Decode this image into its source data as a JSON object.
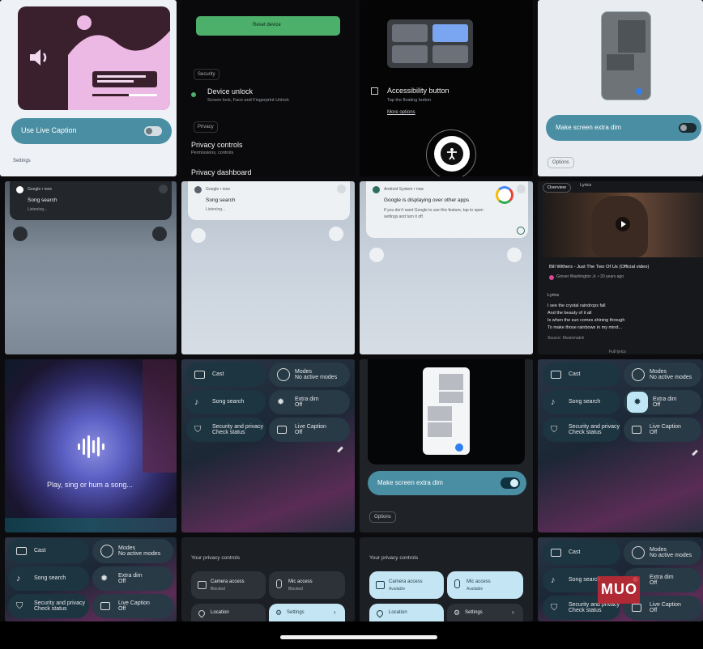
{
  "row1": {
    "t1": {
      "toggle_label": "Use Live Caption",
      "footer": "Settings"
    },
    "t2": {
      "button": "Reset device",
      "section_security": "Security",
      "device_unlock_title": "Device unlock",
      "device_unlock_sub": "Screen lock, Face and Fingerprint Unlock",
      "section_privacy": "Privacy",
      "privacy_controls_title": "Privacy controls",
      "privacy_controls_sub": "Permissions, controls",
      "privacy_dashboard": "Privacy dashboard"
    },
    "t3": {
      "title": "Accessibility button",
      "sub": "Tap the floating button",
      "link": "More options"
    },
    "t4": {
      "toggle_label": "Make screen extra dim",
      "options": "Options"
    }
  },
  "row2": {
    "notif_app": "Google • now",
    "notif_title": "Song search",
    "notif_sub": "Listening...",
    "t3": {
      "app": "Android System • now",
      "title": "Google is displaying over other apps",
      "body1": "If you don't want Google to use this feature, tap to open",
      "body2": "settings and turn it off."
    },
    "t4": {
      "tab_overview": "Overview",
      "tab_lyrics": "Lyrics",
      "video_title": "Bill Withers - Just The Two Of Us (Official video)",
      "channel": "Grover Washington Jr. • 20 years ago",
      "lyrics_header": "Lyrics",
      "lyric1": "I see the crystal raindrops fall",
      "lyric2": "And the beauty of it all",
      "lyric3": "Is when the sun comes shining through",
      "lyric4": "To make those rainbows in my mind...",
      "source": "Source: Musixmatch",
      "more": "Full lyrics"
    }
  },
  "row3": {
    "t1": {
      "prompt": "Play, sing or hum a song..."
    },
    "qs": {
      "cast": "Cast",
      "modes": "Modes",
      "modes_sub": "No active modes",
      "song": "Song search",
      "dim": "Extra dim",
      "dim_sub": "Off",
      "security": "Security and privacy",
      "security_sub": "Check status",
      "livecap": "Live Caption",
      "livecap_sub": "Off"
    },
    "t3": {
      "toggle_label": "Make screen extra dim",
      "options": "Options"
    }
  },
  "row4": {
    "privacy_header": "Your privacy controls",
    "camera": "Camera access",
    "camera_blocked": "Blocked",
    "camera_avail": "Available",
    "mic": "Mic access",
    "mic_blocked": "Blocked",
    "mic_avail": "Available",
    "location": "Location",
    "settings": "Settings"
  },
  "watermark": "MUO",
  "colors": {
    "teal": "#4a8ea3",
    "pink": "#ecb8e4",
    "maroon": "#3a1f2c",
    "green": "#4caf6a",
    "accent_blue": "#2f7ff0",
    "qs_pill": "#1d3540"
  }
}
